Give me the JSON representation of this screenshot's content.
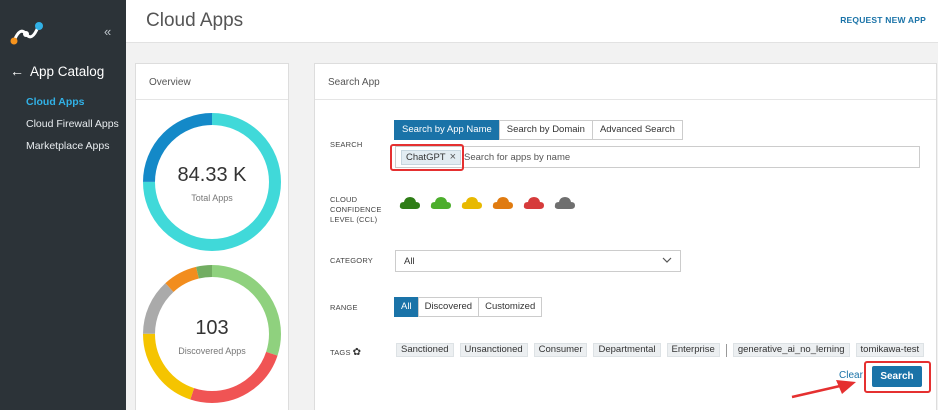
{
  "sidebar": {
    "section_title": "App Catalog",
    "items": [
      {
        "label": "Cloud Apps",
        "active": true
      },
      {
        "label": "Cloud Firewall Apps",
        "active": false
      },
      {
        "label": "Marketplace Apps",
        "active": false
      }
    ]
  },
  "header": {
    "title": "Cloud Apps",
    "request_link": "REQUEST NEW APP"
  },
  "overview": {
    "title": "Overview",
    "total_apps": {
      "value": "84.33 K",
      "label": "Total Apps"
    },
    "discovered_apps": {
      "value": "103",
      "label": "Discovered Apps"
    }
  },
  "search_app": {
    "title": "Search App",
    "search_label": "SEARCH",
    "tabs": [
      "Search by App Name",
      "Search by Domain",
      "Advanced Search"
    ],
    "chip": "ChatGPT",
    "placeholder": "Search for apps by name",
    "ccl_label_1": "CLOUD",
    "ccl_label_2": "CONFIDENCE",
    "ccl_label_3": "LEVEL (CCL)",
    "ccl_colors": [
      "#2e7d16",
      "#4cae2c",
      "#e8b900",
      "#e07b10",
      "#d63b3b",
      "#6f6f6f"
    ],
    "category_label": "CATEGORY",
    "category_value": "All",
    "range_label": "RANGE",
    "range_options": [
      "All",
      "Discovered",
      "Customized"
    ],
    "tags_label": "TAGS",
    "tags": [
      "Sanctioned",
      "Unsanctioned",
      "Consumer",
      "Departmental",
      "Enterprise"
    ],
    "custom_tags": [
      "generative_ai_no_lerning",
      "tomikawa-test"
    ],
    "clear_label": "Clear",
    "search_button": "Search"
  },
  "colors": {
    "accent": "#1a73a8",
    "sidebar_bg": "#2c3338",
    "highlight": "#e53030"
  }
}
